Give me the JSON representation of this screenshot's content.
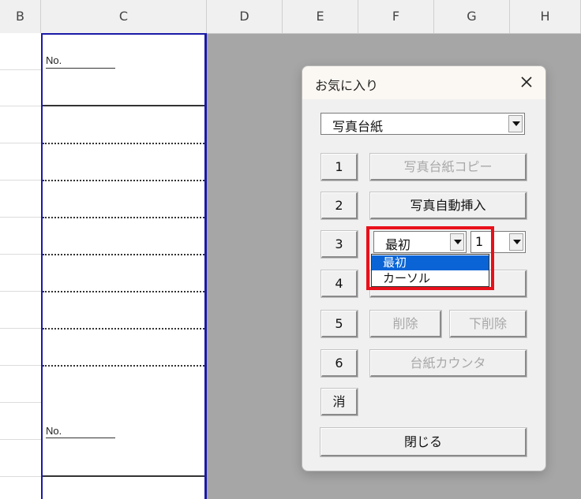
{
  "columns": [
    "B",
    "C",
    "D",
    "E",
    "F",
    "G",
    "H"
  ],
  "sheet": {
    "no_label": "No."
  },
  "dialog": {
    "title": "お気に入り",
    "template_select": "写真台紙",
    "buttons": {
      "b1": "1",
      "b2": "2",
      "b3": "3",
      "b4": "4",
      "b5": "5",
      "b6": "6",
      "clear": "消",
      "copy": "写真台紙コピー",
      "auto_insert": "写真自動挿入",
      "delete": "削除",
      "delete_below": "下削除",
      "counter": "台紙カウンタ",
      "close": "閉じる"
    },
    "position_select": "最初",
    "count_select": "1",
    "dropdown_options": [
      "最初",
      "カーソル"
    ]
  },
  "colors": {
    "accent": "#e8101a",
    "selection": "#0a64d6",
    "sheet_border": "#1a1aa8"
  }
}
